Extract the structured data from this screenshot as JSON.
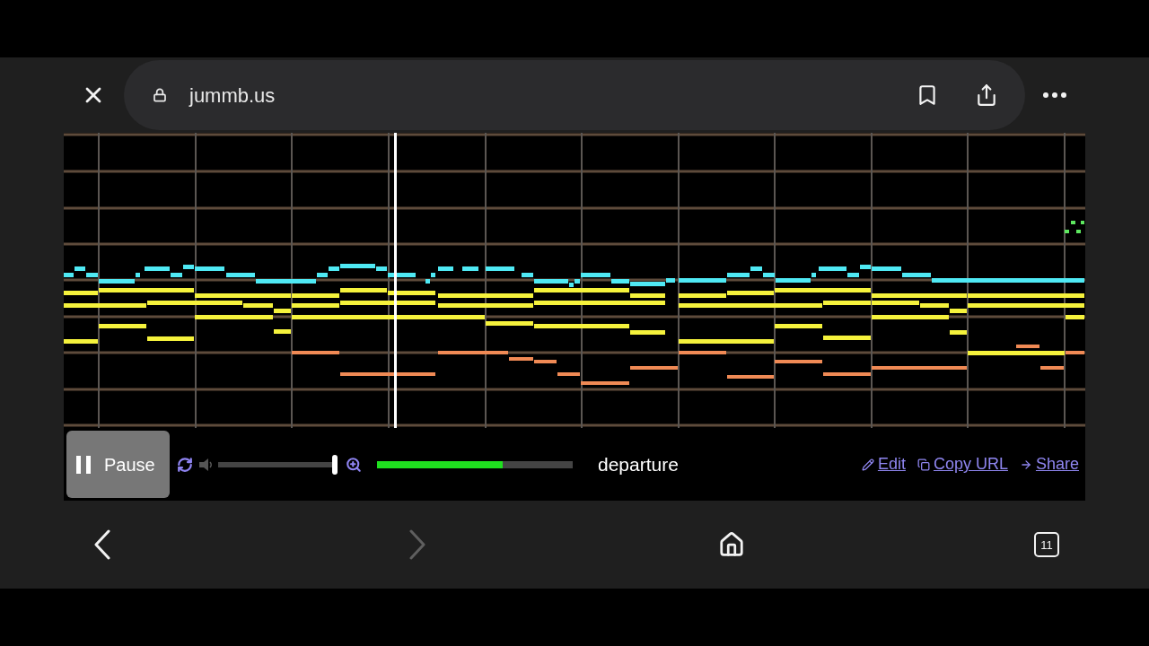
{
  "browser": {
    "url": "jummb.us"
  },
  "player": {
    "play_button": {
      "label": "Pause"
    },
    "volume": {
      "level": 1.0
    },
    "progress": {
      "level": 0.64
    },
    "song_title": "departure",
    "links": [
      {
        "kind": "edit",
        "label": "Edit"
      },
      {
        "kind": "copy",
        "label": "Copy URL"
      },
      {
        "kind": "share",
        "label": "Share"
      }
    ]
  },
  "nav": [
    {
      "kind": "back",
      "disabled": false
    },
    {
      "kind": "forward",
      "disabled": true
    },
    {
      "kind": "home"
    },
    {
      "kind": "tabs",
      "count": "11"
    }
  ]
}
